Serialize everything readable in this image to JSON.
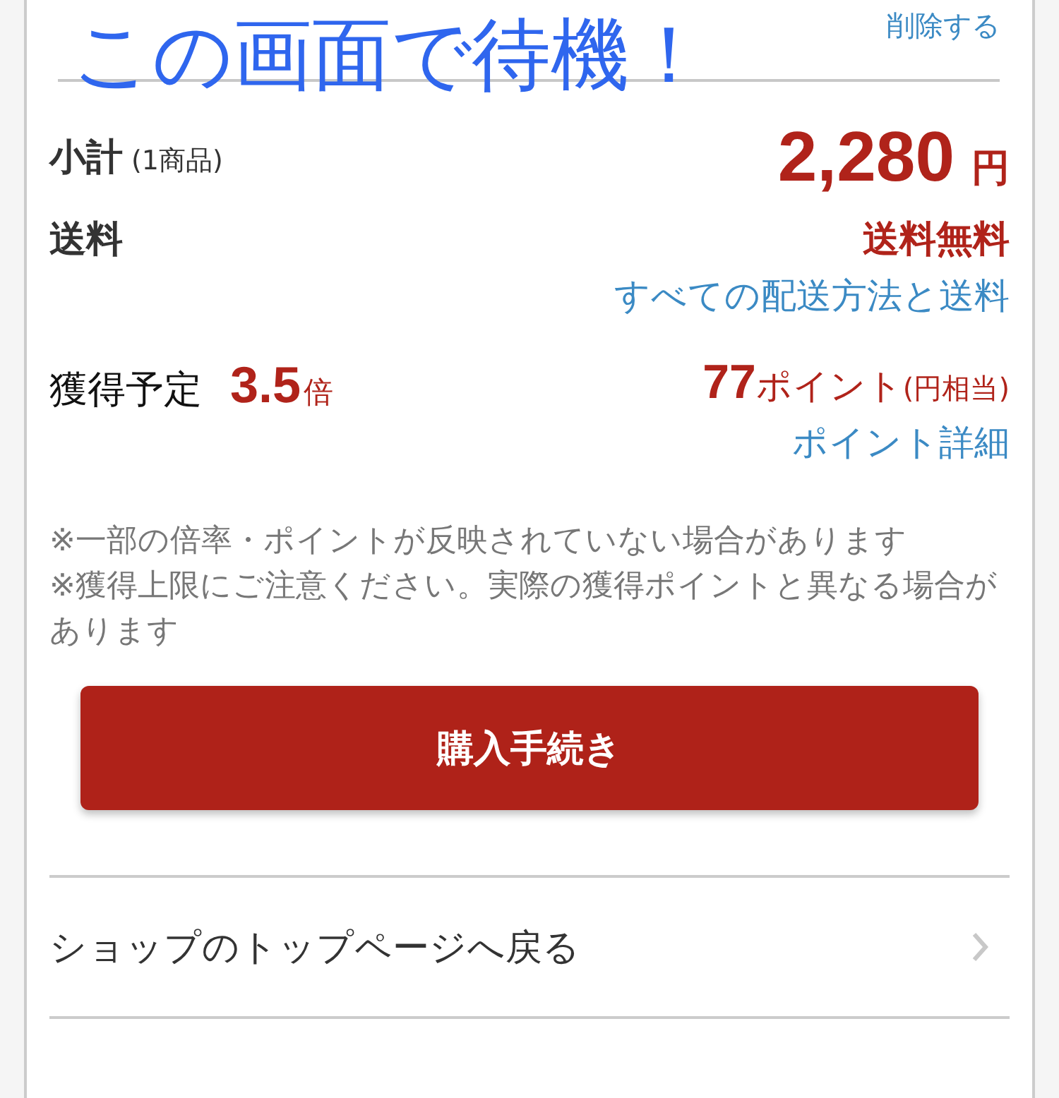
{
  "annotation": "この画面で待機！",
  "delete_link": "削除する",
  "subtotal": {
    "label": "小計",
    "count": "(1商品)",
    "amount": "2,280",
    "currency": "円"
  },
  "shipping": {
    "label": "送料",
    "value": "送料無料",
    "link": "すべての配送方法と送料"
  },
  "points": {
    "label": "獲得予定",
    "rate": "3.5",
    "rate_unit": "倍",
    "amount": "77",
    "amount_unit": "ポイント",
    "note": "(円相当)",
    "link": "ポイント詳細"
  },
  "notes": [
    "※一部の倍率・ポイントが反映されていない場合があります",
    "※獲得上限にご注意ください。実際の獲得ポイントと異なる場合があります"
  ],
  "checkout_button": "購入手続き",
  "back_link": "ショップのトップページへ戻る"
}
